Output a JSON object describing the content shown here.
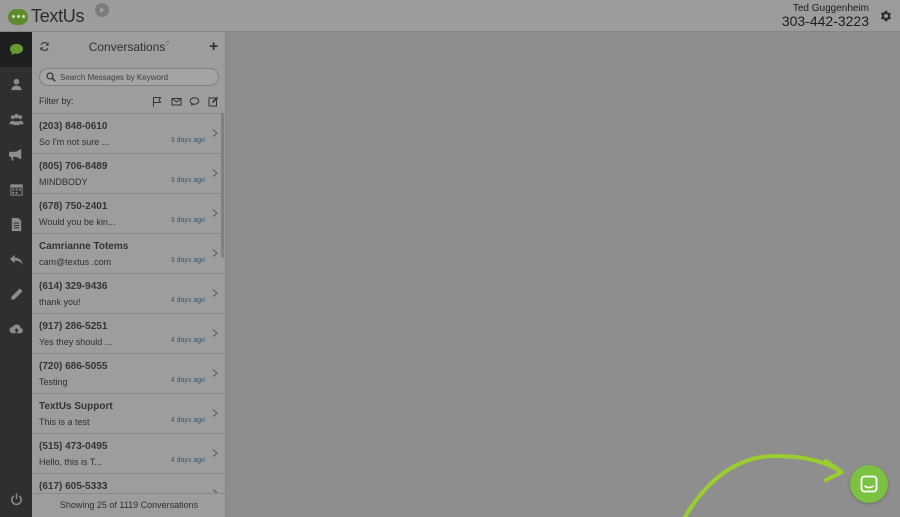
{
  "brand": {
    "logo_text": "TextUs"
  },
  "user": {
    "name": "Ted Guggenheim",
    "phone": "303-442-3223"
  },
  "nav": {
    "items": [
      {
        "icon": "chat-bubble-icon",
        "active": true
      },
      {
        "icon": "person-icon"
      },
      {
        "icon": "group-icon"
      },
      {
        "icon": "megaphone-icon"
      },
      {
        "icon": "calendar-icon"
      },
      {
        "icon": "document-icon"
      },
      {
        "icon": "reply-icon"
      },
      {
        "icon": "pencil-icon"
      },
      {
        "icon": "cloud-upload-icon"
      }
    ],
    "bottom_icon": "power-icon"
  },
  "conversations": {
    "title": "Conversations",
    "help": "?",
    "add_label": "+",
    "search_placeholder": "Search Messages by Keyword",
    "filter_label": "Filter by:",
    "filter_icons": [
      "flag-icon",
      "envelope-icon",
      "chat-icon",
      "compose-icon"
    ],
    "rows": [
      {
        "name": "(203) 848-0610",
        "snippet": "So I'm not sure ...",
        "time": "3 days ago"
      },
      {
        "name": "(805) 706-8489",
        "snippet": "MINDBODY",
        "time": "3 days ago"
      },
      {
        "name": "(678) 750-2401",
        "snippet": "Would you be kin...",
        "time": "3 days ago"
      },
      {
        "name": "Camrianne Totems",
        "snippet": "cam@textus .com",
        "time": "3 days ago"
      },
      {
        "name": "(614) 329-9436",
        "snippet": "thank you!",
        "time": "4 days ago"
      },
      {
        "name": "(917) 286-5251",
        "snippet": "Yes they should ...",
        "time": "4 days ago"
      },
      {
        "name": "(720) 686-5055",
        "snippet": "Testing",
        "time": "4 days ago"
      },
      {
        "name": "TextUs Support",
        "snippet": "This is a test",
        "time": "4 days ago"
      },
      {
        "name": "(515) 473-0495",
        "snippet": "Hello, this is T...",
        "time": "4 days ago"
      },
      {
        "name": "(617) 605-5333",
        "snippet": "",
        "time": ""
      }
    ],
    "footer": "Showing 25 of 1119 Conversations"
  },
  "colors": {
    "accent_green": "#7cc241",
    "nav_bg": "#2e2f31",
    "time_blue": "#3b5670"
  }
}
